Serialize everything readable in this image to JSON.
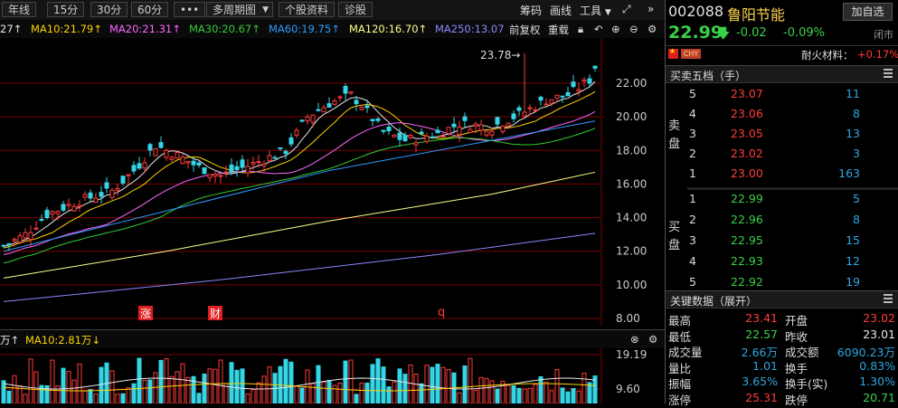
{
  "toolbar": {
    "buttons": [
      "年线",
      "15分",
      "30分",
      "60分",
      "•••",
      "多周期图",
      "个股资料",
      "诊股"
    ],
    "right": [
      "筹码",
      "画线",
      "工具"
    ]
  },
  "ma_row": {
    "items": [
      {
        "text": "27↑",
        "color": "#e8e8e8"
      },
      {
        "text": "MA10:21.79↑",
        "color": "#ffd400"
      },
      {
        "text": "MA20:21.31↑",
        "color": "#ff66ff"
      },
      {
        "text": "MA30:20.67↑",
        "color": "#33cc33"
      },
      {
        "text": "MA60:19.75↑",
        "color": "#2e9bff"
      },
      {
        "text": "MA120:16.70↑",
        "color": "#ffff88"
      },
      {
        "text": "MA250:13.07",
        "color": "#8888ff"
      }
    ],
    "right": [
      "前复权",
      "重载"
    ]
  },
  "chart_data": {
    "type": "candlestick",
    "yticks": [
      "22.00",
      "20.00",
      "18.00",
      "16.00",
      "14.00",
      "12.00",
      "10.00",
      "8.00"
    ],
    "high_label": "23.78→",
    "markers": [
      "涨",
      "财",
      "q"
    ]
  },
  "volume": {
    "header": [
      "万↑",
      "MA10:2.81万↓"
    ],
    "yticks": [
      "19.19",
      "9.60"
    ]
  },
  "quote": {
    "code": "002088",
    "name": "鲁阳节能",
    "add_watch": "加自选",
    "price": "22.99",
    "change": "-0.02",
    "change_pct": "-0.09%",
    "status": "闭市",
    "flag_label": "CHY",
    "sector": "耐火材料：",
    "sector_change": "+0.17%"
  },
  "orderbook": {
    "title": "买卖五档（手）",
    "sell_label": [
      "卖",
      "盘"
    ],
    "buy_label": [
      "买",
      "盘"
    ],
    "sells": [
      {
        "level": "5",
        "price": "23.07",
        "vol": "11"
      },
      {
        "level": "4",
        "price": "23.06",
        "vol": "8"
      },
      {
        "level": "3",
        "price": "23.05",
        "vol": "13"
      },
      {
        "level": "2",
        "price": "23.02",
        "vol": "3"
      },
      {
        "level": "1",
        "price": "23.00",
        "vol": "163"
      }
    ],
    "buys": [
      {
        "level": "1",
        "price": "22.99",
        "vol": "5"
      },
      {
        "level": "2",
        "price": "22.96",
        "vol": "8"
      },
      {
        "level": "3",
        "price": "22.95",
        "vol": "15"
      },
      {
        "level": "4",
        "price": "22.93",
        "vol": "12"
      },
      {
        "level": "5",
        "price": "22.92",
        "vol": "19"
      }
    ]
  },
  "keydata": {
    "title": "关键数据（展开）",
    "rows": [
      {
        "l1": "最高",
        "v1": "23.41",
        "c1": "red",
        "l2": "开盘",
        "v2": "23.02",
        "c2": "red"
      },
      {
        "l1": "最低",
        "v1": "22.57",
        "c1": "green",
        "l2": "昨收",
        "v2": "23.01",
        "c2": "white"
      },
      {
        "l1": "成交量",
        "v1": "2.66万",
        "c1": "cyan",
        "l2": "成交额",
        "v2": "6090.23万",
        "c2": "cyan"
      },
      {
        "l1": "量比",
        "v1": "1.01",
        "c1": "cyan",
        "l2": "换手",
        "v2": "0.83%",
        "c2": "cyan"
      },
      {
        "l1": "振幅",
        "v1": "3.65%",
        "c1": "cyan",
        "l2": "换手(实)",
        "v2": "1.30%",
        "c2": "cyan"
      },
      {
        "l1": "涨停",
        "v1": "25.31",
        "c1": "red",
        "l2": "跌停",
        "v2": "20.71",
        "c2": "green"
      }
    ]
  }
}
